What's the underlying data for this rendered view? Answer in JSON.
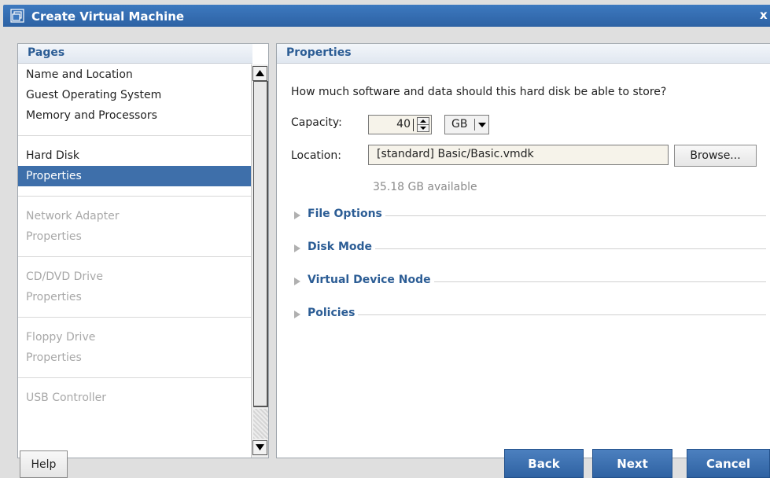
{
  "window": {
    "title": "Create Virtual Machine",
    "close_label": "x"
  },
  "pages_panel": {
    "header": "Pages",
    "groups": [
      [
        "Name and Location",
        "Guest Operating System",
        "Memory and Processors"
      ],
      [
        "Hard Disk",
        "Properties"
      ],
      [
        "Network Adapter",
        "Properties"
      ],
      [
        "CD/DVD Drive",
        "Properties"
      ],
      [
        "Floppy Drive",
        "Properties"
      ],
      [
        "USB Controller"
      ]
    ],
    "selected": "Hard Disk / Properties"
  },
  "properties": {
    "header": "Properties",
    "question": "How much software and data should this hard disk be able to store?",
    "capacity_label": "Capacity:",
    "capacity_value": "40",
    "capacity_unit": "GB",
    "location_label": "Location:",
    "location_value": "[standard] Basic/Basic.vmdk",
    "browse_label": "Browse...",
    "available": "35.18 GB available",
    "sections": [
      "File Options",
      "Disk Mode",
      "Virtual Device Node",
      "Policies"
    ]
  },
  "footer": {
    "help": "Help",
    "back": "Back",
    "next": "Next",
    "cancel": "Cancel"
  },
  "colors": {
    "accent": "#3e6faa",
    "header_text": "#2c5d95"
  }
}
